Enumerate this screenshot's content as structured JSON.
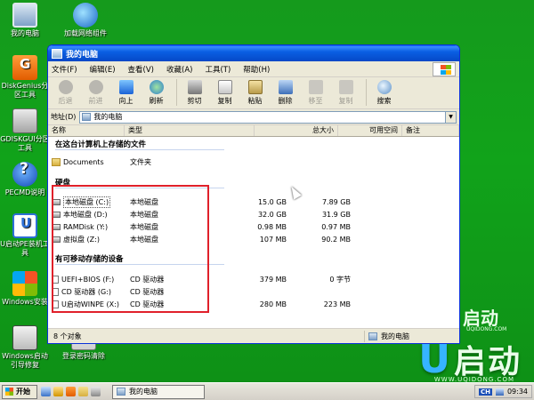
{
  "desktop": {
    "icons": [
      {
        "label": "我的电脑"
      },
      {
        "label": "加载网络组件"
      },
      {
        "label": "DiskGenius分区工具"
      },
      {
        "label": "GDISKGUI分区工具"
      },
      {
        "label": "PECMD说明"
      },
      {
        "label": "U启动PE装机工具"
      },
      {
        "label": "Windows安装"
      },
      {
        "label": "Windows启动引导修复"
      },
      {
        "label": "登录密码清除"
      }
    ],
    "brand_text": "启动",
    "brand_url": "UQIDONG.COM",
    "brand_url_big": "WWW.UQIDONG.COM"
  },
  "window": {
    "title": "我的电脑",
    "menu": [
      "文件(F)",
      "编辑(E)",
      "查看(V)",
      "收藏(A)",
      "工具(T)",
      "帮助(H)"
    ],
    "toolbar": {
      "back": "后退",
      "forward": "前进",
      "up": "向上",
      "refresh": "刷新",
      "cut": "剪切",
      "copy": "复制",
      "paste": "粘贴",
      "delete": "删除",
      "move_to": "移至",
      "copy_to": "复制",
      "search": "搜索"
    },
    "address": {
      "label": "地址(D)",
      "value": "我的电脑"
    },
    "columns": {
      "name": "名称",
      "type": "类型",
      "total": "总大小",
      "free": "可用空间",
      "note": "备注"
    },
    "groups": {
      "files": "在这台计算机上存储的文件",
      "disks": "硬盘",
      "removable": "有可移动存储的设备"
    },
    "files": [
      {
        "name": "Documents",
        "type": "文件夹"
      }
    ],
    "disks": [
      {
        "name": "本地磁盘 (C:)",
        "type": "本地磁盘",
        "total": "15.0 GB",
        "free": "7.89 GB"
      },
      {
        "name": "本地磁盘 (D:)",
        "type": "本地磁盘",
        "total": "32.0 GB",
        "free": "31.9 GB"
      },
      {
        "name": "RAMDisk (Y:)",
        "type": "本地磁盘",
        "total": "0.98 MB",
        "free": "0.97 MB"
      },
      {
        "name": "虚拟盘 (Z:)",
        "type": "本地磁盘",
        "total": "107 MB",
        "free": "90.2 MB"
      }
    ],
    "removable": [
      {
        "name": "UEFI+BIOS (F:)",
        "type": "CD 驱动器",
        "total": "379 MB",
        "free": "0 字节"
      },
      {
        "name": "CD 驱动器 (G:)",
        "type": "CD 驱动器",
        "total": "",
        "free": ""
      },
      {
        "name": "U启动WINPE (X:)",
        "type": "CD 驱动器",
        "total": "280 MB",
        "free": "223 MB"
      }
    ],
    "status": {
      "count": "8 个对象",
      "location": "我的电脑"
    }
  },
  "taskbar": {
    "start": "开始",
    "task": "我的电脑",
    "lang": "CH",
    "time": "09:34"
  }
}
